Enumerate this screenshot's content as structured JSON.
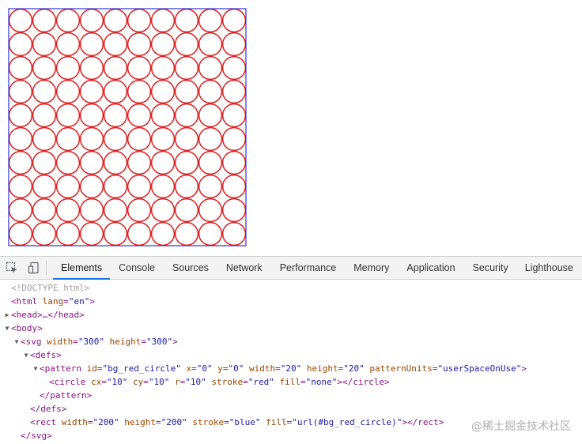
{
  "preview": {
    "svg_width": 300,
    "svg_height": 300,
    "rect_width": 200,
    "rect_height": 200,
    "circle_stroke": "#dd2222",
    "rect_stroke": "#3333cc"
  },
  "devtools": {
    "tabs": [
      {
        "label": "Elements",
        "active": true
      },
      {
        "label": "Console",
        "active": false
      },
      {
        "label": "Sources",
        "active": false
      },
      {
        "label": "Network",
        "active": false
      },
      {
        "label": "Performance",
        "active": false
      },
      {
        "label": "Memory",
        "active": false
      },
      {
        "label": "Application",
        "active": false
      },
      {
        "label": "Security",
        "active": false
      },
      {
        "label": "Lighthouse",
        "active": false
      }
    ],
    "icons": [
      "inspect-element-icon",
      "device-toolbar-icon"
    ],
    "dom_lines": [
      {
        "indent": 0,
        "toggle": "none",
        "tokens": [
          [
            "doctype",
            "<!DOCTYPE html>"
          ]
        ]
      },
      {
        "indent": 0,
        "toggle": "none",
        "tokens": [
          [
            "punct",
            "<"
          ],
          [
            "tag",
            "html"
          ],
          [
            "plain",
            " "
          ],
          [
            "attr-name",
            "lang"
          ],
          [
            "punct",
            "="
          ],
          [
            "attr-val",
            "\"en\""
          ],
          [
            "punct",
            ">"
          ]
        ]
      },
      {
        "indent": 0,
        "toggle": "collapsed",
        "tokens": [
          [
            "punct",
            "<"
          ],
          [
            "tag",
            "head"
          ],
          [
            "punct",
            ">"
          ],
          [
            "ellipsis",
            "…"
          ],
          [
            "punct",
            "</"
          ],
          [
            "tag",
            "head"
          ],
          [
            "punct",
            ">"
          ]
        ]
      },
      {
        "indent": 0,
        "toggle": "expanded",
        "tokens": [
          [
            "punct",
            "<"
          ],
          [
            "tag",
            "body"
          ],
          [
            "punct",
            ">"
          ]
        ]
      },
      {
        "indent": 1,
        "toggle": "expanded",
        "tokens": [
          [
            "punct",
            "<"
          ],
          [
            "tag",
            "svg"
          ],
          [
            "plain",
            " "
          ],
          [
            "attr-name",
            "width"
          ],
          [
            "punct",
            "="
          ],
          [
            "attr-val",
            "\"300\""
          ],
          [
            "plain",
            " "
          ],
          [
            "attr-name",
            "height"
          ],
          [
            "punct",
            "="
          ],
          [
            "attr-val",
            "\"300\""
          ],
          [
            "punct",
            ">"
          ]
        ]
      },
      {
        "indent": 2,
        "toggle": "expanded",
        "tokens": [
          [
            "punct",
            "<"
          ],
          [
            "tag",
            "defs"
          ],
          [
            "punct",
            ">"
          ]
        ]
      },
      {
        "indent": 3,
        "toggle": "expanded",
        "tokens": [
          [
            "punct",
            "<"
          ],
          [
            "tag",
            "pattern"
          ],
          [
            "plain",
            " "
          ],
          [
            "attr-name",
            "id"
          ],
          [
            "punct",
            "="
          ],
          [
            "attr-val",
            "\"bg_red_circle\""
          ],
          [
            "plain",
            " "
          ],
          [
            "attr-name",
            "x"
          ],
          [
            "punct",
            "="
          ],
          [
            "attr-val",
            "\"0\""
          ],
          [
            "plain",
            " "
          ],
          [
            "attr-name",
            "y"
          ],
          [
            "punct",
            "="
          ],
          [
            "attr-val",
            "\"0\""
          ],
          [
            "plain",
            " "
          ],
          [
            "attr-name",
            "width"
          ],
          [
            "punct",
            "="
          ],
          [
            "attr-val",
            "\"20\""
          ],
          [
            "plain",
            " "
          ],
          [
            "attr-name",
            "height"
          ],
          [
            "punct",
            "="
          ],
          [
            "attr-val",
            "\"20\""
          ],
          [
            "plain",
            " "
          ],
          [
            "attr-name",
            "patternUnits"
          ],
          [
            "punct",
            "="
          ],
          [
            "attr-val",
            "\"userSpaceOnUse\""
          ],
          [
            "punct",
            ">"
          ]
        ]
      },
      {
        "indent": 4,
        "toggle": "none",
        "tokens": [
          [
            "punct",
            "<"
          ],
          [
            "tag",
            "circle"
          ],
          [
            "plain",
            " "
          ],
          [
            "attr-name",
            "cx"
          ],
          [
            "punct",
            "="
          ],
          [
            "attr-val",
            "\"10\""
          ],
          [
            "plain",
            " "
          ],
          [
            "attr-name",
            "cy"
          ],
          [
            "punct",
            "="
          ],
          [
            "attr-val",
            "\"10\""
          ],
          [
            "plain",
            " "
          ],
          [
            "attr-name",
            "r"
          ],
          [
            "punct",
            "="
          ],
          [
            "attr-val",
            "\"10\""
          ],
          [
            "plain",
            " "
          ],
          [
            "attr-name",
            "stroke"
          ],
          [
            "punct",
            "="
          ],
          [
            "attr-val",
            "\"red\""
          ],
          [
            "plain",
            " "
          ],
          [
            "attr-name",
            "fill"
          ],
          [
            "punct",
            "="
          ],
          [
            "attr-val",
            "\"none\""
          ],
          [
            "punct",
            "></"
          ],
          [
            "tag",
            "circle"
          ],
          [
            "punct",
            ">"
          ]
        ]
      },
      {
        "indent": 3,
        "toggle": "none",
        "tokens": [
          [
            "punct",
            "</"
          ],
          [
            "tag",
            "pattern"
          ],
          [
            "punct",
            ">"
          ]
        ]
      },
      {
        "indent": 2,
        "toggle": "none",
        "tokens": [
          [
            "punct",
            "</"
          ],
          [
            "tag",
            "defs"
          ],
          [
            "punct",
            ">"
          ]
        ]
      },
      {
        "indent": 2,
        "toggle": "none",
        "tokens": [
          [
            "punct",
            "<"
          ],
          [
            "tag",
            "rect"
          ],
          [
            "plain",
            " "
          ],
          [
            "attr-name",
            "width"
          ],
          [
            "punct",
            "="
          ],
          [
            "attr-val",
            "\"200\""
          ],
          [
            "plain",
            " "
          ],
          [
            "attr-name",
            "height"
          ],
          [
            "punct",
            "="
          ],
          [
            "attr-val",
            "\"200\""
          ],
          [
            "plain",
            " "
          ],
          [
            "attr-name",
            "stroke"
          ],
          [
            "punct",
            "="
          ],
          [
            "attr-val",
            "\"blue\""
          ],
          [
            "plain",
            " "
          ],
          [
            "attr-name",
            "fill"
          ],
          [
            "punct",
            "="
          ],
          [
            "attr-val",
            "\"url(#bg_red_circle)\""
          ],
          [
            "punct",
            "></"
          ],
          [
            "tag",
            "rect"
          ],
          [
            "punct",
            ">"
          ]
        ]
      },
      {
        "indent": 1,
        "toggle": "none",
        "tokens": [
          [
            "punct",
            "</"
          ],
          [
            "tag",
            "svg"
          ],
          [
            "punct",
            ">"
          ]
        ]
      }
    ]
  },
  "watermark": "@稀土掘金技术社区"
}
